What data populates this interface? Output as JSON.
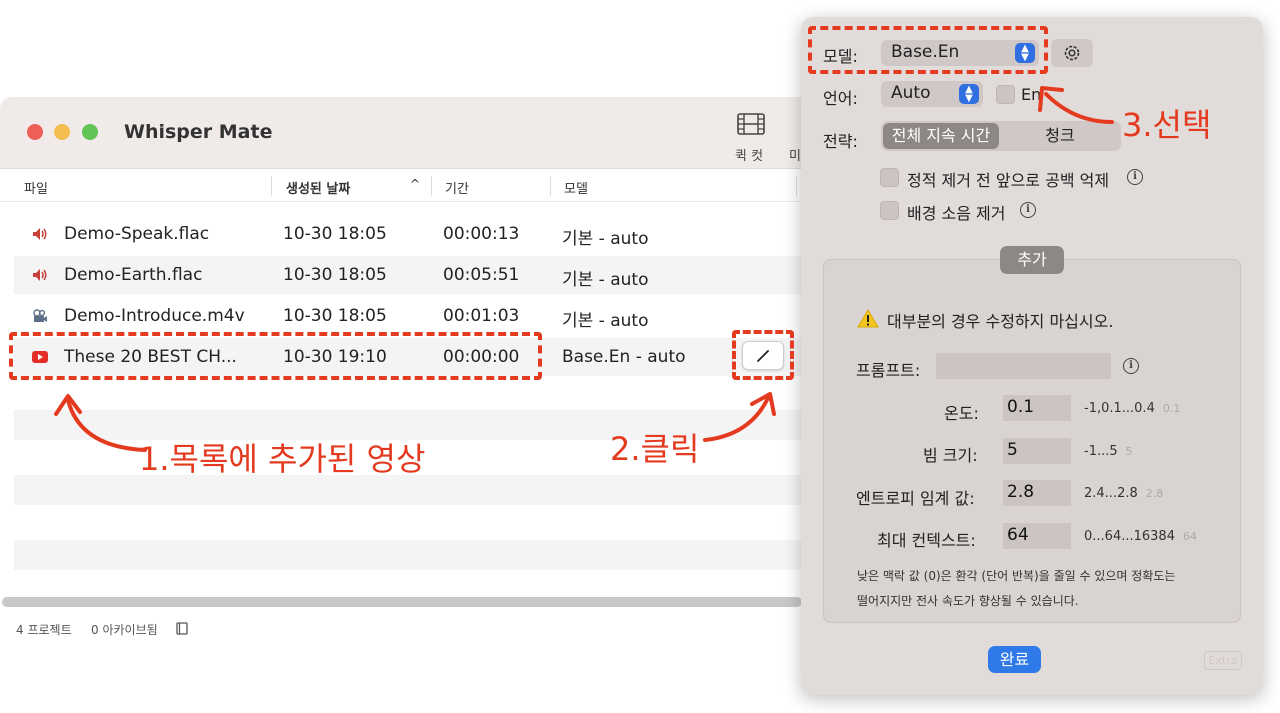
{
  "window": {
    "title": "Whisper Mate",
    "toolbar": {
      "quickcut_label": "퀵 컷",
      "more_label": "미"
    }
  },
  "table": {
    "columns": [
      "파일",
      "생성된 날짜",
      "기간",
      "모델"
    ],
    "sort_indicator": "^",
    "rows": [
      {
        "icon": "speaker-icon",
        "file": "Demo-Speak.flac",
        "date": "10-30 18:05",
        "duration": "00:00:13",
        "model": "기본 - auto"
      },
      {
        "icon": "speaker-icon",
        "file": "Demo-Earth.flac",
        "date": "10-30 18:05",
        "duration": "00:05:51",
        "model": "기본 - auto"
      },
      {
        "icon": "video-camera-icon",
        "file": "Demo-Introduce.m4v",
        "date": "10-30 18:05",
        "duration": "00:01:03",
        "model": "기본 - auto"
      },
      {
        "icon": "youtube-icon",
        "file": "These 20 BEST CH...",
        "date": "10-30 19:10",
        "duration": "00:00:00",
        "model": "Base.En - auto"
      }
    ]
  },
  "status_bar": {
    "projects": "4 프로젝트",
    "archived": "0 아카이브됨"
  },
  "panel": {
    "model_label": "모델:",
    "model_value": "Base.En",
    "language_label": "언어:",
    "language_value": "Auto",
    "en_checkbox_label": "En",
    "strategy_label": "전략:",
    "strategy_options": [
      "전체 지속 시간",
      "청크"
    ],
    "options": [
      {
        "label": "정적 제거 전 앞으로 공백 억제"
      },
      {
        "label": "배경 소음 제거"
      }
    ],
    "advanced_tab": "추가",
    "warning": "대부분의 경우 수정하지 마십시오.",
    "prompt_label": "프롬프트:",
    "prompt_value": "",
    "params": [
      {
        "label": "온도:",
        "value": "0.1",
        "range": "-1,0.1...0.4",
        "default": "0.1"
      },
      {
        "label": "빔 크기:",
        "value": "5",
        "range": "-1...5",
        "default": "5"
      },
      {
        "label": "엔트로피 임계 값:",
        "value": "2.8",
        "range": "2.4...2.8",
        "default": "2.8"
      },
      {
        "label": "최대 컨텍스트:",
        "value": "64",
        "range": "0...64...16384",
        "default": "64"
      }
    ],
    "note_line1": "낮은 맥락 값 (0)은 환각 (단어 반복)을 줄일 수 있으며 정확도는",
    "note_line2": "떨어지지만 전사 속도가 향상될 수 있습니다.",
    "done_label": "완료",
    "extra_label": "Extra"
  },
  "annotations": {
    "step1": "1.목록에 추가된 영상",
    "step2": "2.클릭",
    "step3": "3.선택"
  },
  "colors": {
    "annotation": "#e43a1f",
    "accent": "#2f7ae8",
    "traffic_red": "#ee5f57",
    "traffic_yellow": "#f5bd4f",
    "traffic_green": "#61c454"
  }
}
